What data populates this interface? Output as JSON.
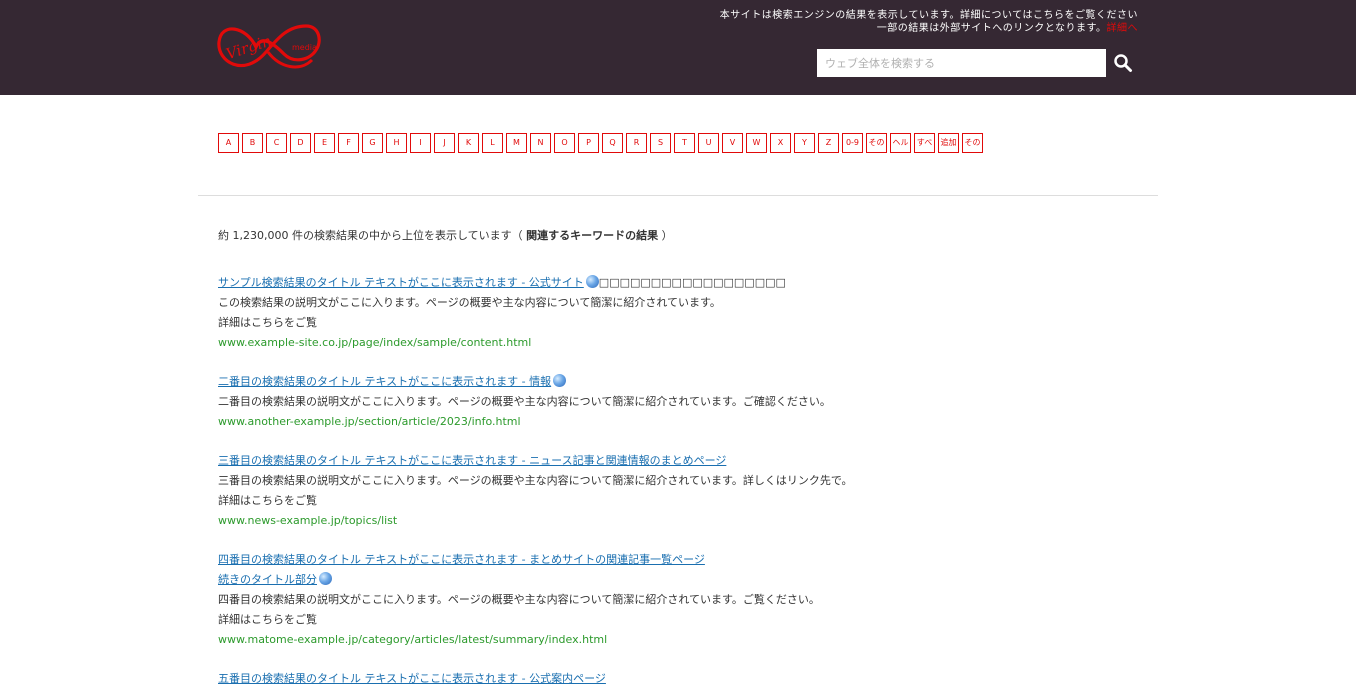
{
  "brand": {
    "name": "Virgin media",
    "accent": "#e10a0a",
    "header_bg": "#352833"
  },
  "header": {
    "notice_line1": "本サイトは検索エンジンの結果を表示しています。詳細についてはこちらをご覧ください",
    "notice_line2": "一部の結果は外部サイトへのリンクとなります。",
    "notice_link": "詳細へ"
  },
  "search": {
    "placeholder": "ウェブ全体を検索する",
    "icon": "search-icon"
  },
  "alpha_index": [
    "A",
    "B",
    "C",
    "D",
    "E",
    "F",
    "G",
    "H",
    "I",
    "J",
    "K",
    "L",
    "M",
    "N",
    "O",
    "P",
    "Q",
    "R",
    "S",
    "T",
    "U",
    "V",
    "W",
    "X",
    "Y",
    "Z",
    "0-9",
    "その他",
    "ヘルプ",
    "すべて",
    "追加",
    "その他"
  ],
  "summary": {
    "prefix": "約 1,230,000 件の検索結果の中から上位を表示しています（ ",
    "bold": "関連するキーワードの結果",
    "suffix": " ）"
  },
  "results": [
    {
      "title": "サンプル検索結果のタイトル テキストがここに表示されます - 公式サイト",
      "tail": "□□□□□□□□□□□□□□□□□□",
      "has_globe": true,
      "desc1": "この検索結果の説明文がここに入ります。ページの概要や主な内容について簡潔に紹介されています。",
      "desc2": "詳細はこちらをご覧",
      "url": "www.example-site.co.jp/page/index/sample/content.html"
    },
    {
      "title": "二番目の検索結果のタイトル テキストがここに表示されます - 情報",
      "tail": "",
      "has_globe": true,
      "desc1": "二番目の検索結果の説明文がここに入ります。ページの概要や主な内容について簡潔に紹介されています。ご確認ください。",
      "desc2": "",
      "url": "www.another-example.jp/section/article/2023/info.html"
    },
    {
      "title": "三番目の検索結果のタイトル テキストがここに表示されます - ニュース記事と関連情報のまとめページ",
      "tail": "",
      "has_globe": false,
      "desc1": "三番目の検索結果の説明文がここに入ります。ページの概要や主な内容について簡潔に紹介されています。詳しくはリンク先で。",
      "desc2": "詳細はこちらをご覧",
      "url": "www.news-example.jp/topics/list"
    },
    {
      "title": "四番目の検索結果のタイトル テキストがここに表示されます - まとめサイトの関連記事一覧ページ",
      "title2": "続きのタイトル部分",
      "tail": "",
      "has_globe": true,
      "desc1": "四番目の検索結果の説明文がここに入ります。ページの概要や主な内容について簡潔に紹介されています。ご覧ください。",
      "desc2": "詳細はこちらをご覧",
      "url": "www.matome-example.jp/category/articles/latest/summary/index.html"
    },
    {
      "title": "五番目の検索結果のタイトル テキストがここに表示されます - 公式案内ページ",
      "tail": "",
      "has_globe": false,
      "desc1": "",
      "desc2": "",
      "url": ""
    }
  ]
}
